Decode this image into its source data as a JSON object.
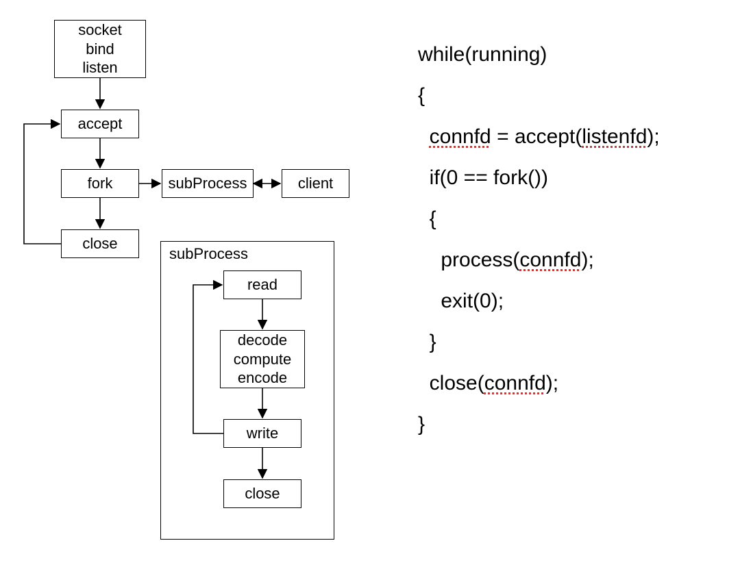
{
  "diagram": {
    "main": {
      "init": "socket\nbind\nlisten",
      "accept": "accept",
      "fork": "fork",
      "close": "close",
      "subprocess": "subProcess",
      "client": "client"
    },
    "sub": {
      "label": "subProcess",
      "read": "read",
      "decode": "decode\ncompute\nencode",
      "write": "write",
      "close": "close"
    }
  },
  "code": {
    "l1_a": "while(running)",
    "l2_a": "{",
    "l3_a": "  ",
    "l3_b": "connfd",
    "l3_c": " = accept(",
    "l3_d": "listenfd",
    "l3_e": ");",
    "l4_a": "  if(0 == fork())",
    "l5_a": "  {",
    "l6_a": "    process(",
    "l6_b": "connfd",
    "l6_c": ");",
    "l7_a": "    exit(0);",
    "l8_a": "  }",
    "l9_a": "  close(",
    "l9_b": "connfd",
    "l9_c": ");",
    "l10_a": "}"
  }
}
